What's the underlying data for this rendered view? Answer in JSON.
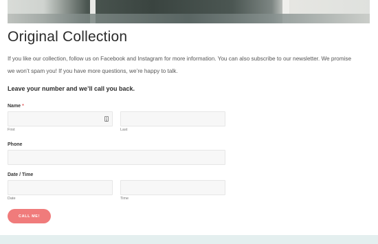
{
  "page": {
    "title": "Original Collection",
    "intro": "If you like our collection, follow us on Facebook and Instagram for more information. You can also subscribe to our newsletter. We promise we won’t spam you! If you have more questions, we’re happy to talk.",
    "callback_heading": "Leave your number and we’ll call you back."
  },
  "form": {
    "name_label": "Name",
    "required_mark": "*",
    "first_sublabel": "First",
    "last_sublabel": "Last",
    "phone_label": "Phone",
    "datetime_label": "Date / Time",
    "date_sublabel": "Date",
    "time_sublabel": "Time",
    "first_value": "",
    "last_value": "",
    "phone_value": "",
    "date_value": "",
    "time_value": "",
    "submit_label": "CALL ME!"
  },
  "icons": {
    "contact_card": "contact-card-icon"
  },
  "colors": {
    "accent": "#f07b7b",
    "required": "#e05c5c",
    "footer": "#e4efef"
  }
}
